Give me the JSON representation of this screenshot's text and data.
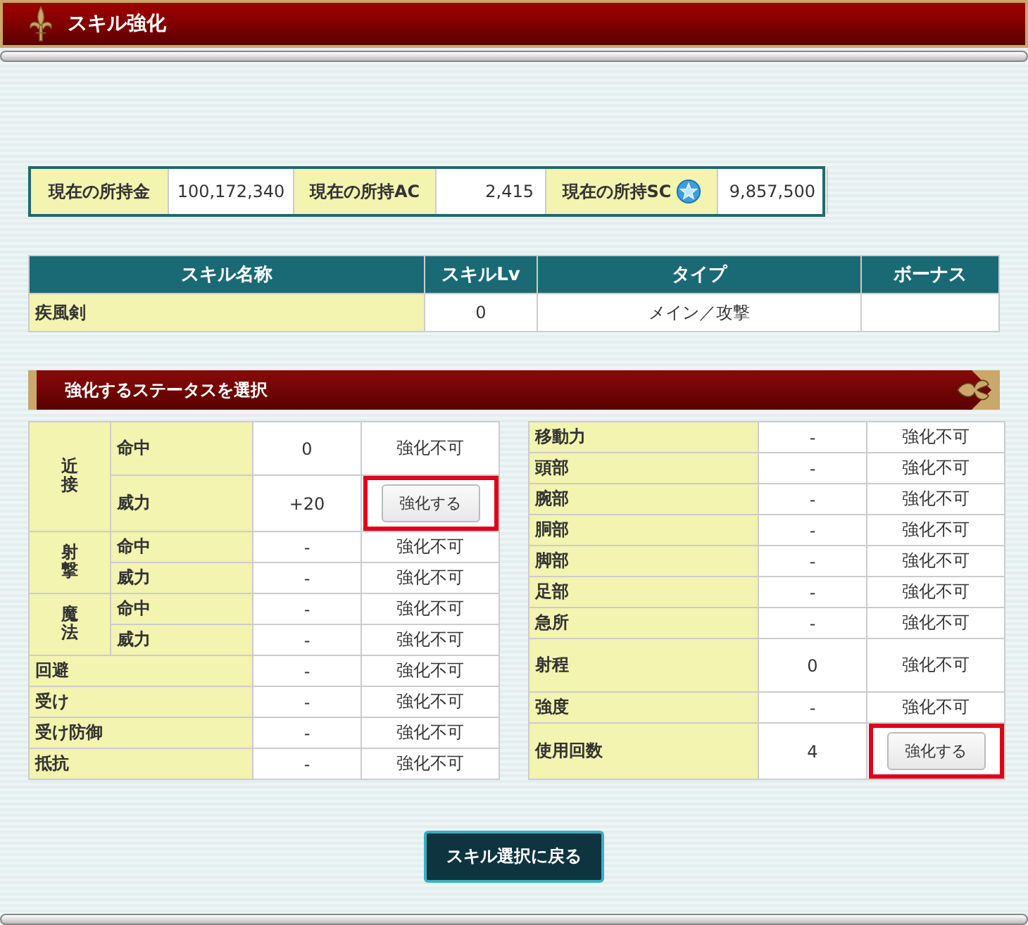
{
  "window": {
    "title": "スキル強化"
  },
  "holdings": [
    {
      "label": "現在の所持金",
      "value": "100,172,340",
      "kind": "plain"
    },
    {
      "label": "現在の所持AC",
      "value": "2,415",
      "kind": "plain"
    },
    {
      "label": "現在の所持SC",
      "value": "9,857,500",
      "kind": "coin"
    }
  ],
  "skill_table": {
    "columns": [
      "スキル名称",
      "スキルLv",
      "タイプ",
      "ボーナス"
    ],
    "rows": [
      {
        "name": "疾風剣",
        "level": "0",
        "type": "メイン／攻撃"
      }
    ]
  },
  "section_title": "強化するステータスを選択",
  "left_stats": [
    {
      "label": "近接",
      "children": [
        {
          "label": "命中",
          "value": "0",
          "kind": "text",
          "action": "強化不可"
        },
        {
          "label": "威力",
          "value": "+20",
          "kind": "button",
          "action": "強化する"
        }
      ]
    },
    {
      "label": "射撃",
      "children": [
        {
          "label": "命中",
          "value": "-",
          "kind": "text",
          "action": "強化不可"
        },
        {
          "label": "威力",
          "value": "-",
          "kind": "text",
          "action": "強化不可"
        }
      ]
    },
    {
      "label": "魔法",
      "children": [
        {
          "label": "命中",
          "value": "-",
          "kind": "text",
          "action": "強化不可"
        },
        {
          "label": "威力",
          "value": "-",
          "kind": "text",
          "action": "強化不可"
        }
      ]
    },
    {
      "label": "回避",
      "value": "-",
      "kind": "text",
      "action": "強化不可"
    },
    {
      "label": "受け",
      "value": "-",
      "kind": "text",
      "action": "強化不可"
    },
    {
      "label": "受け防御",
      "value": "-",
      "kind": "text",
      "action": "強化不可"
    },
    {
      "label": "抵抗",
      "value": "-",
      "kind": "text",
      "action": "強化不可"
    }
  ],
  "right_stats": [
    {
      "label": "移動力",
      "value": "-",
      "kind": "text",
      "action": "強化不可"
    },
    {
      "label": "頭部",
      "value": "-",
      "kind": "text",
      "action": "強化不可"
    },
    {
      "label": "腕部",
      "value": "-",
      "kind": "text",
      "action": "強化不可"
    },
    {
      "label": "胴部",
      "value": "-",
      "kind": "text",
      "action": "強化不可"
    },
    {
      "label": "脚部",
      "value": "-",
      "kind": "text",
      "action": "強化不可"
    },
    {
      "label": "足部",
      "value": "-",
      "kind": "text",
      "action": "強化不可"
    },
    {
      "label": "急所",
      "value": "-",
      "kind": "text",
      "action": "強化不可"
    },
    {
      "label": "射程",
      "value": "0",
      "kind": "text",
      "action": "強化不可"
    },
    {
      "label": "強度",
      "value": "-",
      "kind": "text",
      "action": "強化不可"
    },
    {
      "label": "使用回数",
      "value": "4",
      "kind": "button",
      "action": "強化する"
    }
  ],
  "back_button": "スキル選択に戻る"
}
